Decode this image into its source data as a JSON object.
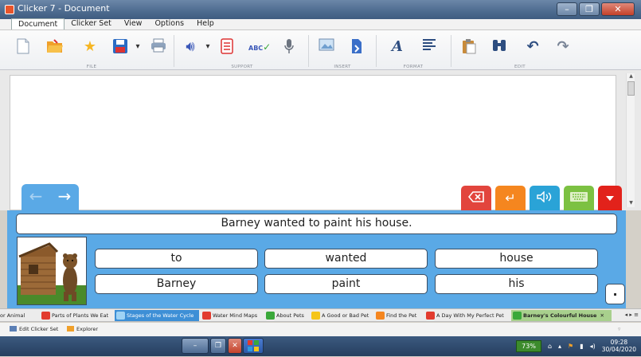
{
  "window": {
    "title": "Clicker 7 - Document"
  },
  "menu": {
    "tabs": [
      "Document",
      "Clicker Set",
      "View",
      "Options",
      "Help"
    ]
  },
  "ribbon": {
    "groups": [
      {
        "label": "FILE"
      },
      {
        "label": "SUPPORT"
      },
      {
        "label": "INSERT"
      },
      {
        "label": "FORMAT"
      },
      {
        "label": "EDIT"
      }
    ]
  },
  "clicker": {
    "sentence": "Barney wanted to paint his house.",
    "words": [
      [
        "to",
        "wanted",
        "house"
      ],
      [
        "Barney",
        "paint",
        "his"
      ]
    ],
    "full_stop": ".",
    "colors": {
      "panel": "#5aa9e6",
      "delete": "#e2453d",
      "enter": "#f5861f",
      "speak": "#2aa3d7",
      "keyboard": "#7cc142"
    }
  },
  "set_tabs": [
    {
      "label": "or Animal",
      "icon": ""
    },
    {
      "label": "Parts of Plants We Eat",
      "icon": "#e23b2e"
    },
    {
      "label": "Stages of the Water Cycle",
      "icon": "#2f9be0"
    },
    {
      "label": "Water Mind Maps",
      "icon": "#e23b2e"
    },
    {
      "label": "About Pets",
      "icon": "#3aa83a"
    },
    {
      "label": "A Good or Bad Pet",
      "icon": "#f5c518"
    },
    {
      "label": "Find the Pet",
      "icon": "#f5861f"
    },
    {
      "label": "A Day With My Perfect Pet",
      "icon": "#e23b2e"
    },
    {
      "label": "Barney's Colourful House",
      "icon": "#3aa83a"
    }
  ],
  "status": {
    "edit_set": "Edit Clicker Set",
    "explorer": "Explorer"
  },
  "taskbar": {
    "battery": "73%",
    "time": "09:28",
    "date": "30/04/2020"
  }
}
